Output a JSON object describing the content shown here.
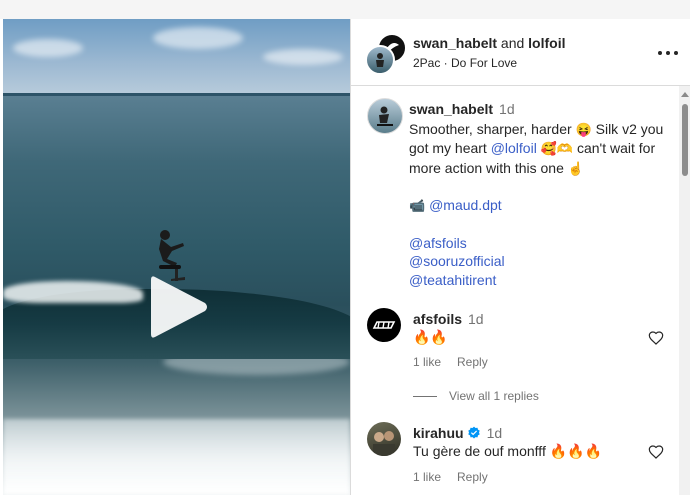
{
  "header": {
    "author": "swan_habelt",
    "connector": "and",
    "collaborator": "lolfoil",
    "audio": "2Pac · Do For Love",
    "more_icon": "more-horizontal-icon"
  },
  "video": {
    "play_icon": "play-icon"
  },
  "caption": {
    "username": "swan_habelt",
    "time": "1d",
    "line1_text": "Smoother, sharper, harder ",
    "line1_emoji": "😝",
    "line1_text2": " Silk v2 you got my heart ",
    "mention_lolfoil": "@lolfoil",
    "emoji_love": "🥰🫶",
    "line1_text3": " can't wait for more action with this one ",
    "emoji_point": "☝️",
    "camera_emoji": "📹",
    "mention_camera": "@maud.dpt",
    "tags": [
      "@afsfoils",
      "@sooruzofficial",
      "@teatahitirent"
    ]
  },
  "comments": [
    {
      "username": "afsfoils",
      "time": "1d",
      "text": "🔥🔥",
      "likes": "1 like",
      "reply": "Reply",
      "view_replies": "View all 1 replies"
    },
    {
      "username": "kirahuu",
      "verified": true,
      "time": "1d",
      "text": "Tu gère de ouf monfff 🔥🔥🔥",
      "likes": "1 like",
      "reply": "Reply"
    }
  ],
  "colors": {
    "link": "#3a5ec7",
    "verified": "#0095f6",
    "muted": "#737373",
    "text": "#262626"
  }
}
